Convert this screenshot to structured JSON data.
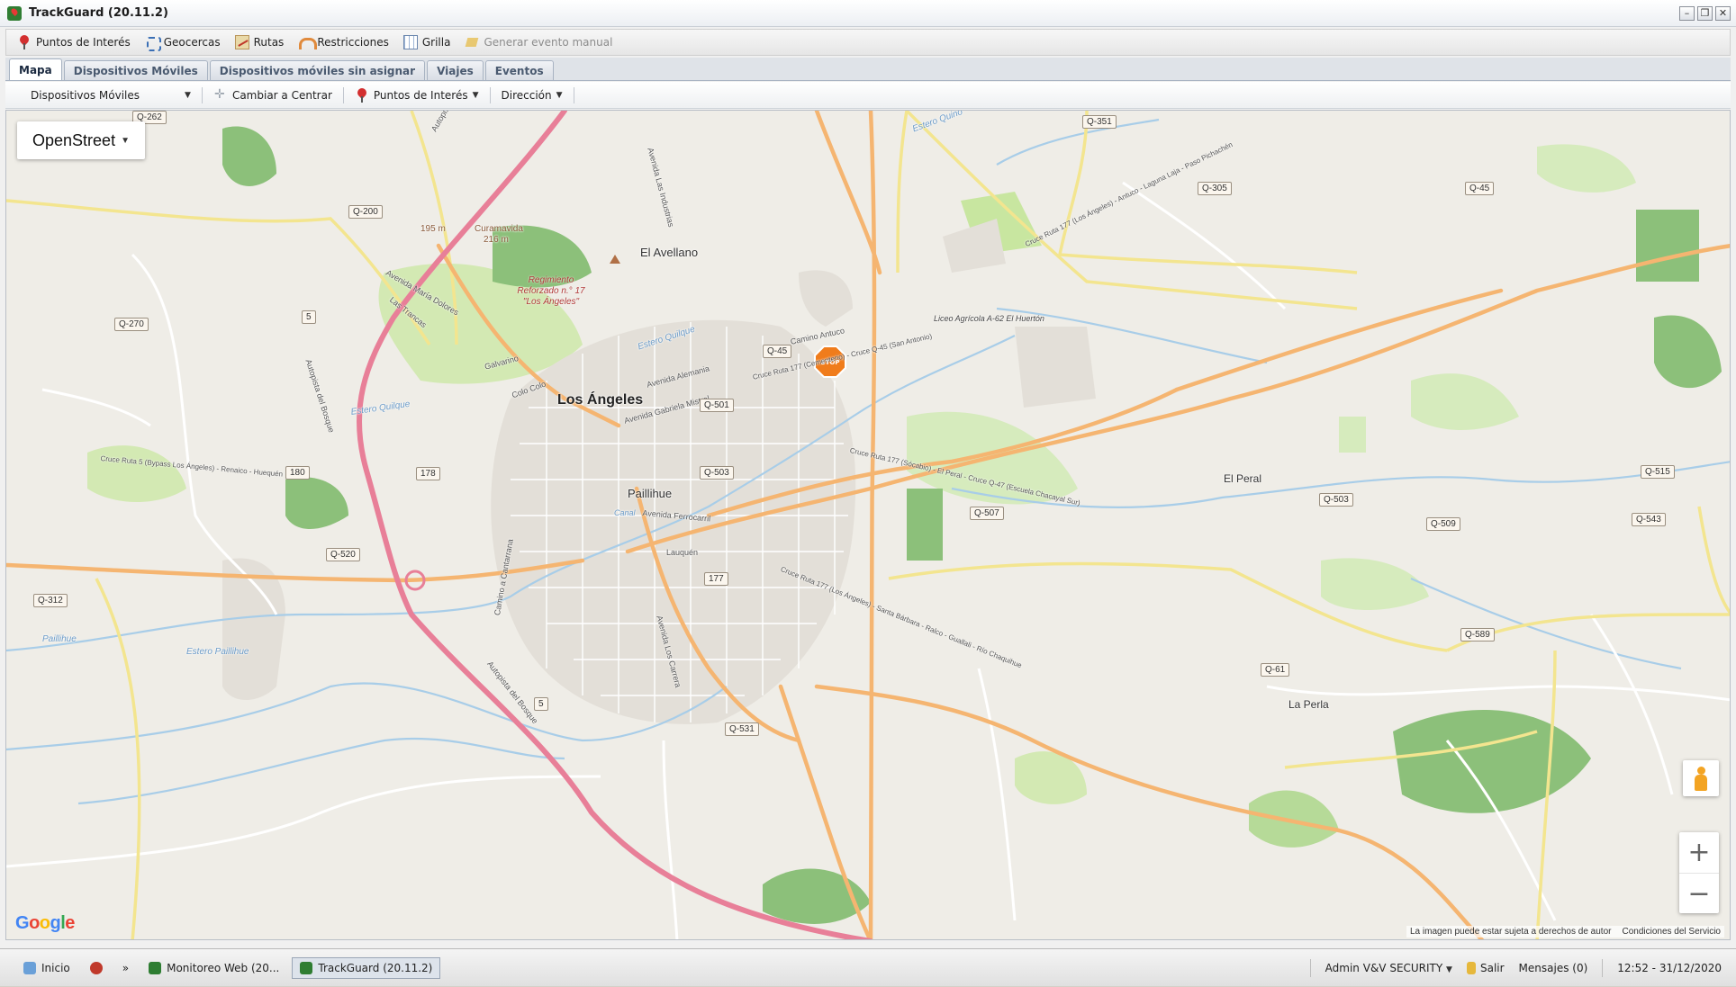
{
  "window": {
    "title": "TrackGuard (20.11.2)"
  },
  "toolbar": {
    "items": [
      {
        "label": "Puntos de Interés",
        "icon": "map-pin-icon"
      },
      {
        "label": "Geocercas",
        "icon": "geofence-icon"
      },
      {
        "label": "Rutas",
        "icon": "route-icon"
      },
      {
        "label": "Restricciones",
        "icon": "restriction-icon"
      },
      {
        "label": "Grilla",
        "icon": "grid-icon"
      },
      {
        "label": "Generar evento manual",
        "icon": "event-icon",
        "disabled": true
      }
    ]
  },
  "tabs": [
    {
      "label": "Mapa",
      "active": true
    },
    {
      "label": "Dispositivos Móviles"
    },
    {
      "label": "Dispositivos móviles sin asignar"
    },
    {
      "label": "Viajes"
    },
    {
      "label": "Eventos"
    }
  ],
  "map_toolbar": {
    "devices_label": "Dispositivos Móviles",
    "center_label": "Cambiar a Centrar",
    "poi_label": "Puntos de Interés",
    "address_label": "Dirección"
  },
  "map": {
    "type_selector": "OpenStreet",
    "google_logo": "Google",
    "attribution": "La imagen puede estar sujeta a derechos de autor",
    "terms": "Condiciones del Servicio",
    "zoom_in": "+",
    "zoom_out": "−",
    "labels": {
      "city": "Los Ángeles",
      "el_avellano": "El Avellano",
      "paillihue": "Paillihue",
      "el_peral": "El Peral",
      "la_perla": "La Perla",
      "curamavida": "Curamavida",
      "curamavida_alt": "216 m",
      "elev_195": "195 m",
      "regimiento": "Regimiento Reforzado n.° 17 \"Los Ángeles\"",
      "liceo": "Liceo Agrícola A-62 El Huertón",
      "estero_quilque": "Estero Quilque",
      "estero_paillihue": "Estero Paillihue",
      "paillihue_water": "Paillihue",
      "estero_quilque2": "Estero Quilque",
      "autopista": "Autopista del Bosque",
      "autopista2": "Autopista del Bosque",
      "autopista3": "Autopista del Bosque",
      "camino_antuco": "Camino Antuco",
      "av_alemania": "Avenida Alemania",
      "av_gabriela": "Avenida Gabriela Mistral",
      "av_industrias": "Avenida Las Industrias",
      "av_ferrocarril": "Avenida Ferrocarril",
      "lauquen": "Lauquén",
      "cruce_ruta5": "Cruce Ruta 5 (Bypass Los Ángeles) - Renaico - Huequén",
      "cruce_177_cem": "Cruce Ruta 177 (Cementerio) - Cruce Q-45 (San Antonio)",
      "cruce_177_antuco": "Cruce Ruta 177 (Los Ángeles) - Antuco - Laguna Laja - Paso Pichachén",
      "cruce_177_socabio": "Cruce Ruta 177 (Sócabio) - El Peral - Cruce Q-47 (Escuela Chacayal Sur)",
      "cruce_177_santa": "Cruce Ruta 177 (Los Ángeles) - Santa Bárbara - Ralco - Guallali - Río Chaquihue",
      "colo_colo": "Colo Colo",
      "galvarino": "Galvarino",
      "las_trancas": "Las Trancas",
      "maria_dolores": "Avenida María Dolores",
      "cam_cantarrana": "Camino a Cantarrana",
      "av_los_carrera": "Avenida Los Carrera",
      "estero_quino": "Estero Quino",
      "canal": "Canal",
      "stop_icon": "stop-sign-icon"
    },
    "shields": [
      "Q-262",
      "Q-351",
      "Q-305",
      "Q-45",
      "Q-200",
      "Q-270",
      "5",
      "Q-45",
      "Q-501",
      "180",
      "178",
      "Q-503",
      "Q-507",
      "Q-503",
      "Q-515",
      "Q-509",
      "Q-543",
      "Q-520",
      "177",
      "Q-312",
      "Q-589",
      "Q-61",
      "5",
      "Q-531"
    ]
  },
  "taskbar": {
    "start": "Inicio",
    "more": "»",
    "tasks": [
      {
        "label": "Monitoreo Web (20...",
        "active": false
      },
      {
        "label": "TrackGuard (20.11.2)",
        "active": true
      }
    ],
    "user": "Admin V&V SECURITY",
    "logout": "Salir",
    "messages": "Mensajes (0)",
    "clock": "12:52 - 31/12/2020"
  },
  "colors": {
    "map_bg": "#efede7",
    "major_road": "#f5b571",
    "highway": "#e87f98",
    "water": "#a8cde8",
    "park": "#c8e6a0",
    "forest": "#76b06a",
    "urban": "#e3dfd8"
  }
}
